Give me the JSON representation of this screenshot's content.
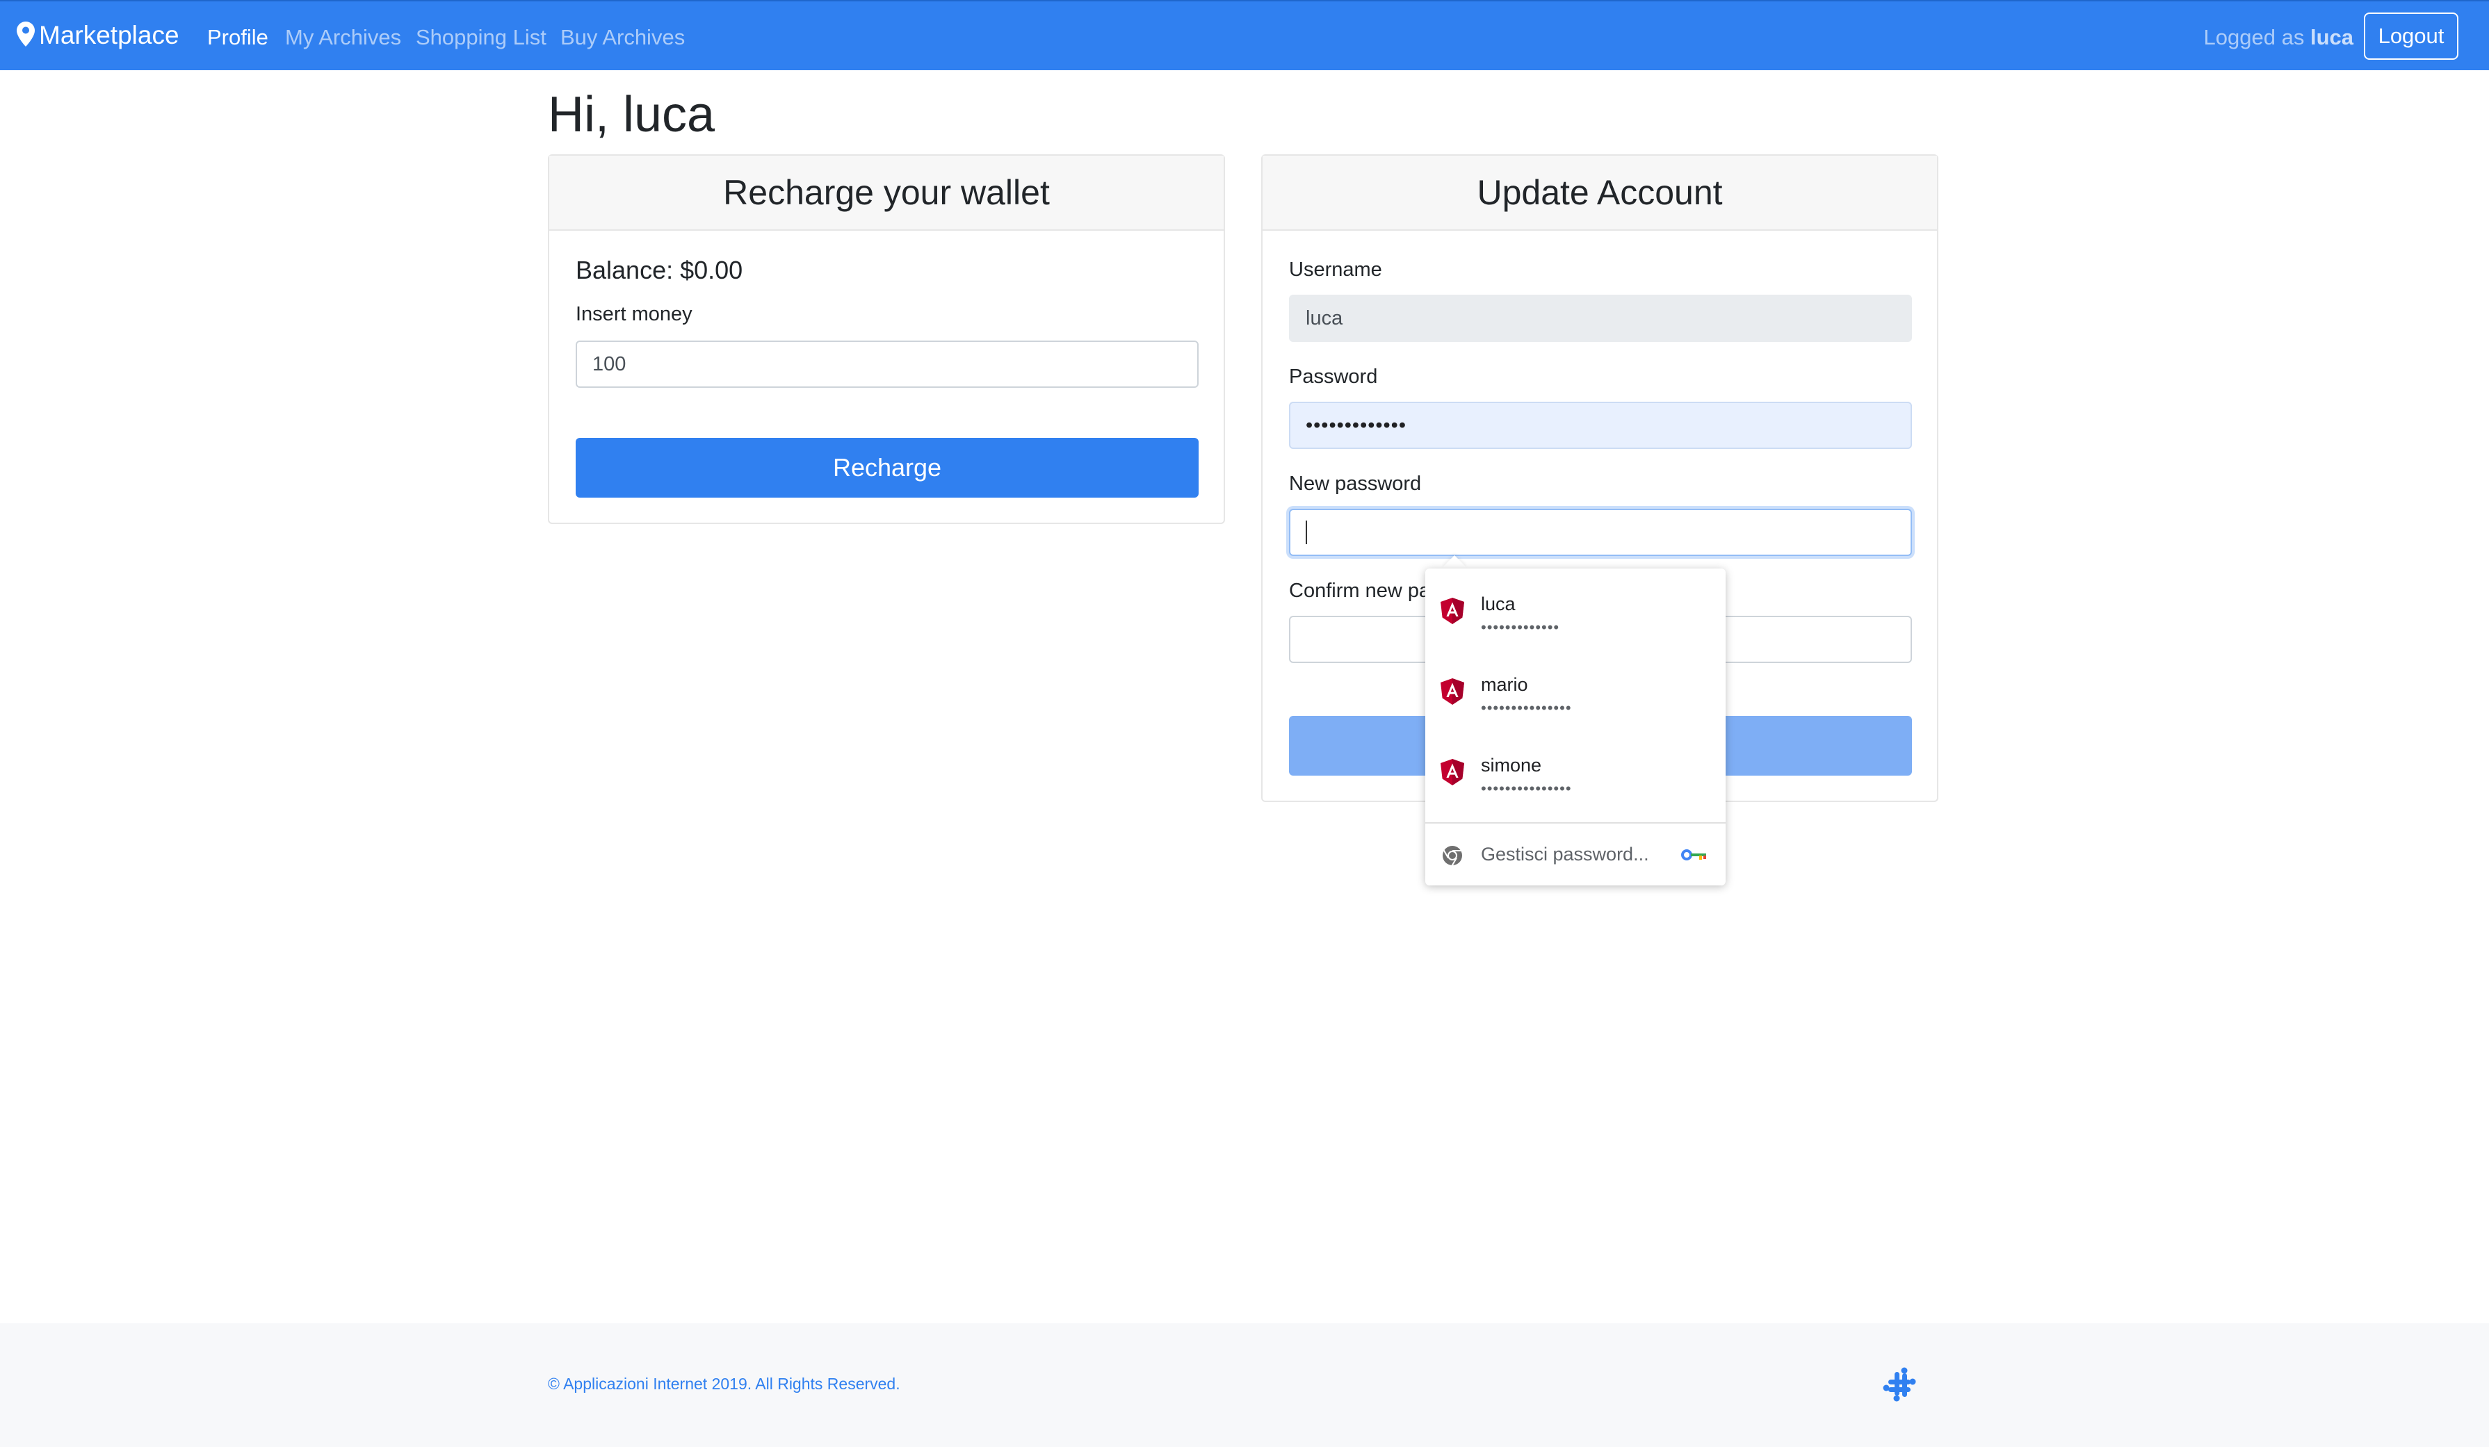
{
  "navbar": {
    "brand": "Marketplace",
    "links": [
      "Profile",
      "My Archives",
      "Shopping List",
      "Buy Archives"
    ],
    "logged_prefix": "Logged as",
    "logged_user": "luca",
    "logout_label": "Logout"
  },
  "greeting": "Hi, luca",
  "wallet": {
    "title": "Recharge your wallet",
    "balance": "Balance: $0.00",
    "insert_label": "Insert money",
    "insert_value": "100",
    "recharge_label": "Recharge"
  },
  "account": {
    "title": "Update Account",
    "username_label": "Username",
    "username_value": "luca",
    "password_label": "Password",
    "password_value": "•••••••••••••",
    "new_password_label": "New password",
    "new_password_value": "",
    "confirm_label_visible": "Confirm new pa",
    "confirm_value": ""
  },
  "autofill": {
    "accounts": [
      {
        "name": "luca",
        "dots": "•••••••••••••"
      },
      {
        "name": "mario",
        "dots": "•••••••••••••••"
      },
      {
        "name": "simone",
        "dots": "•••••••••••••••"
      }
    ],
    "manage_label": "Gestisci password..."
  },
  "footer": {
    "copyright": "© Applicazioni Internet 2019. All Rights Reserved."
  },
  "colors": {
    "primary": "#3080f0",
    "primary_disabled": "#7eaef5",
    "readonly_bg": "#e9ecef",
    "autofill_bg": "#e8f0fe",
    "angular_red": "#c3002f"
  },
  "icons": [
    "map-marker-icon",
    "angular-icon",
    "chrome-icon",
    "key-icon",
    "slack-icon"
  ]
}
